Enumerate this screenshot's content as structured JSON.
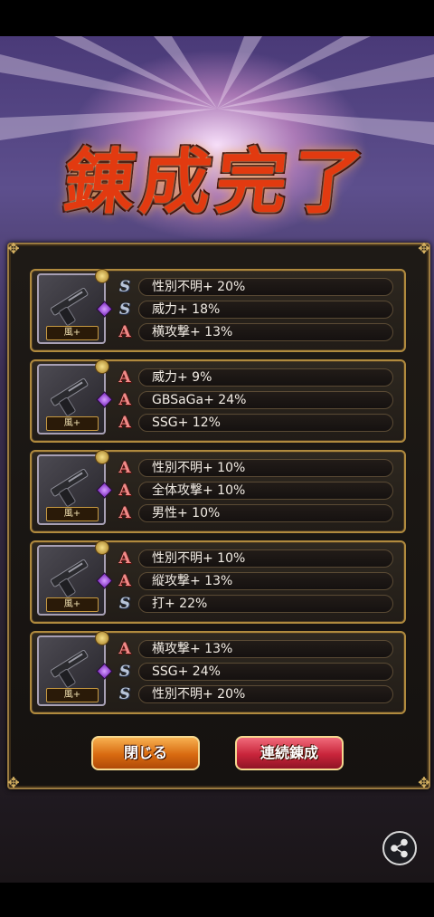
{
  "title": "錬成完了",
  "items": [
    {
      "weapon_label": "風+",
      "stats": [
        {
          "rank": "S",
          "text": "性別不明+ 20%"
        },
        {
          "rank": "S",
          "text": "威力+ 18%"
        },
        {
          "rank": "A",
          "text": "横攻撃+ 13%"
        }
      ]
    },
    {
      "weapon_label": "風+",
      "stats": [
        {
          "rank": "A",
          "text": "威力+ 9%"
        },
        {
          "rank": "A",
          "text": "GBSaGa+ 24%"
        },
        {
          "rank": "A",
          "text": "SSG+ 12%"
        }
      ]
    },
    {
      "weapon_label": "風+",
      "stats": [
        {
          "rank": "A",
          "text": "性別不明+ 10%"
        },
        {
          "rank": "A",
          "text": "全体攻撃+ 10%"
        },
        {
          "rank": "A",
          "text": "男性+ 10%"
        }
      ]
    },
    {
      "weapon_label": "風+",
      "stats": [
        {
          "rank": "A",
          "text": "性別不明+ 10%"
        },
        {
          "rank": "A",
          "text": "縦攻撃+ 13%"
        },
        {
          "rank": "S",
          "text": "打+ 22%"
        }
      ]
    },
    {
      "weapon_label": "風+",
      "stats": [
        {
          "rank": "A",
          "text": "横攻撃+ 13%"
        },
        {
          "rank": "S",
          "text": "SSG+ 24%"
        },
        {
          "rank": "S",
          "text": "性別不明+ 20%"
        }
      ]
    }
  ],
  "buttons": {
    "close_label": "閉じる",
    "repeat_label": "連続錬成"
  },
  "icons": {
    "share": "share-icon",
    "weapon": "pistol-icon",
    "gem": "purple-gem-icon",
    "coin": "gold-coin-icon"
  },
  "colors": {
    "rank_s": "#b8c4d8",
    "rank_a": "#f08a88",
    "frame_gold": "#b08a3e",
    "button_orange": "#d86a10",
    "button_red": "#c8243a"
  }
}
